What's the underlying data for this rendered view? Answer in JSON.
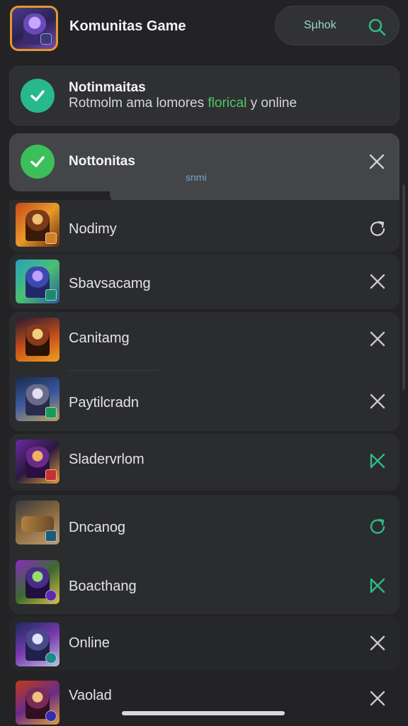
{
  "header": {
    "title": "Komunitas Game",
    "search_label": "Sµhok"
  },
  "notifications": [
    {
      "title": "Notinmaitas",
      "subtitle_before": "Rotmolm ama lomores ",
      "subtitle_highlight": "florical",
      "subtitle_after": " y online",
      "status": "check"
    },
    {
      "title": "Nottonitas",
      "subtitle": "snmi",
      "status": "check"
    }
  ],
  "items": [
    {
      "label": "Nodimy",
      "action": "refresh-icon"
    },
    {
      "label": "Sbavsacamg",
      "action": "close-icon"
    },
    {
      "label": "Canitamg",
      "action": "close-icon"
    },
    {
      "label": "Paytilcradn",
      "action": "close-icon"
    },
    {
      "label": "Sladervrlom",
      "action": "close-icon"
    },
    {
      "label": "Dncanog",
      "action": "refresh-icon"
    },
    {
      "label": "Boacthang",
      "action": "close-icon"
    },
    {
      "label": "Online",
      "action": "close-icon"
    },
    {
      "label": "Vaolad",
      "action": "close-icon"
    }
  ],
  "colors": {
    "background": "#232325",
    "accent_green": "#2fb88a",
    "check_green": "#3bbf5a",
    "icon_gray": "#c8c8cc"
  }
}
